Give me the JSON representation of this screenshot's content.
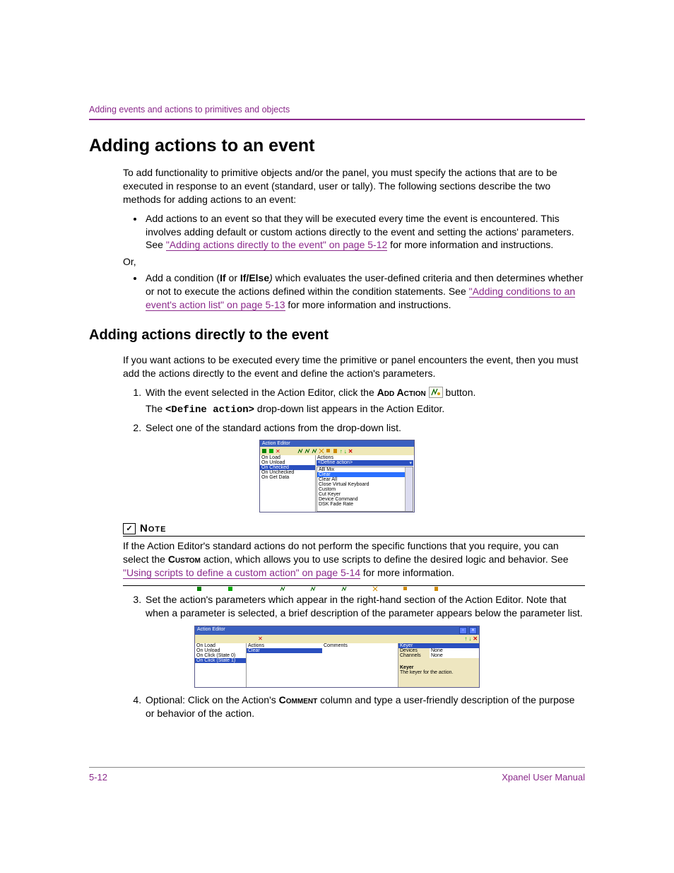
{
  "breadcrumb": "Adding events and actions to primitives and objects",
  "h1": "Adding actions to an event",
  "intro": "To add functionality to primitive objects and/or the panel, you must specify the actions that are to be executed in response to an event (standard, user or tally). The following sections describe the two methods for adding actions to an event:",
  "bullet1_a": "Add actions to an event so that they will be executed every time the event is encountered. This involves adding default or custom actions directly to the event and setting the actions' parameters. See ",
  "bullet1_link": "\"Adding actions directly to the event\" on page 5-12",
  "bullet1_b": " for more information and instructions.",
  "orline": "Or,",
  "bullet2_a": "Add a condition (",
  "bullet2_if": "If",
  "bullet2_or": " or ",
  "bullet2_ifelse": "If/Else",
  "bullet2_paren": ")",
  "bullet2_b": " which evaluates the user-defined criteria and then determines whether or not to execute the actions defined within the condition statements. See ",
  "bullet2_link": "\"Adding conditions to an event's action list\" on page 5-13",
  "bullet2_c": " for more information and instructions.",
  "h2": "Adding actions directly to the event",
  "sub_intro": "If you want actions to be executed every time the primitive or panel encounters the event, then you must add the actions directly to the event and define the action's parameters.",
  "step1_a": "With the event selected in the Action Editor, click the ",
  "step1_sc": "Add Action",
  "step1_b": "  button.",
  "step1_line2_a": "The ",
  "step1_mono": "<Define action>",
  "step1_line2_b": "  drop-down list appears in the Action Editor.",
  "step2": "Select one of the standard actions from the drop-down list.",
  "fig1": {
    "title": "Action Editor",
    "events": [
      "On Load",
      "On Unload",
      "On Checked",
      "On Unchecked",
      "On Get Data"
    ],
    "selected_event_index": 2,
    "actions_hdr": "Actions",
    "combo": "<Define action>",
    "options": [
      "AB Mix",
      "Clear",
      "Clear All",
      "Close Virtual Keyboard",
      "Custom",
      "Cut Keyer",
      "Device Command",
      "DSK Fade Rate"
    ],
    "highlight_index": 1
  },
  "note_label": "Note",
  "note_body_a": "If the Action Editor's standard actions do not perform the specific functions that you require, you can select the ",
  "note_sc": "Custom",
  "note_body_b": " action, which allows you to use scripts to define the desired logic and behavior. See ",
  "note_link": "\"Using scripts to define a custom action\" on page 5-14",
  "note_body_c": " for more information.",
  "step3": "Set the action's parameters which appear in the right-hand section of the Action Editor. Note that when a parameter is selected, a brief description of the parameter appears below the parameter list.",
  "fig2": {
    "title": "Action Editor",
    "events": [
      "On Load",
      "On Unload",
      "On Click (State 0)",
      "On Click (State 1)"
    ],
    "selected_event_index": 3,
    "col_actions": "Actions",
    "col_comments": "Comments",
    "row_action": "Clear",
    "props_header": "Keyer",
    "props": [
      {
        "k": "Devices",
        "v": "None"
      },
      {
        "k": "Channels",
        "v": "None"
      }
    ],
    "desc_head": "Keyer",
    "desc_body": "The keyer for the action."
  },
  "step4_a": "Optional: Click on the Action's ",
  "step4_sc": "Comment",
  "step4_b": " column and type a user-friendly description of the purpose or behavior of the action.",
  "footer_left": "5-12",
  "footer_right": "Xpanel User Manual"
}
